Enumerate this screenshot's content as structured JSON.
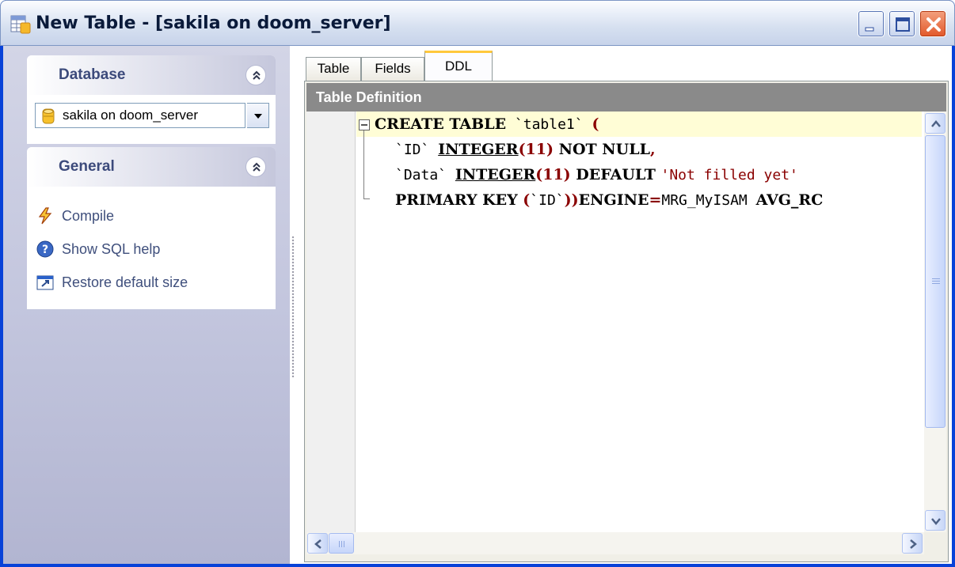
{
  "window": {
    "title": "New Table - [sakila on doom_server]",
    "accent_color": "#0842d8"
  },
  "sidebar": {
    "database_group": {
      "title": "Database",
      "selected_database": "sakila on doom_server"
    },
    "general_group": {
      "title": "General",
      "items": [
        {
          "label": "Compile",
          "icon": "lightning-icon"
        },
        {
          "label": "Show SQL help",
          "icon": "help-icon"
        },
        {
          "label": "Restore default size",
          "icon": "restore-size-icon"
        }
      ]
    }
  },
  "tabs": [
    {
      "label": "Table",
      "active": false
    },
    {
      "label": "Fields",
      "active": false
    },
    {
      "label": "DDL",
      "active": true
    }
  ],
  "ddl_panel": {
    "header": "Table Definition",
    "lines": [
      {
        "kw1": "CREATE TABLE",
        "id1": " `table1` ",
        "p1": "("
      },
      {
        "id1": "`ID` ",
        "ty1": "INTEGER",
        "p1": "(11)",
        "kw1": " NOT NULL",
        "p2": ","
      },
      {
        "id1": "`Data` ",
        "ty1": "INTEGER",
        "p1": "(11)",
        "kw1": " DEFAULT ",
        "str1": "'Not filled yet'"
      },
      {
        "kw1": "PRIMARY KEY ",
        "p1": "(",
        "id1": "`ID`",
        "p2": "))",
        "kw2": "ENGINE",
        "p3": "=",
        "id2": "MRG_MyISAM ",
        "kw3": "AVG_RC"
      }
    ]
  }
}
